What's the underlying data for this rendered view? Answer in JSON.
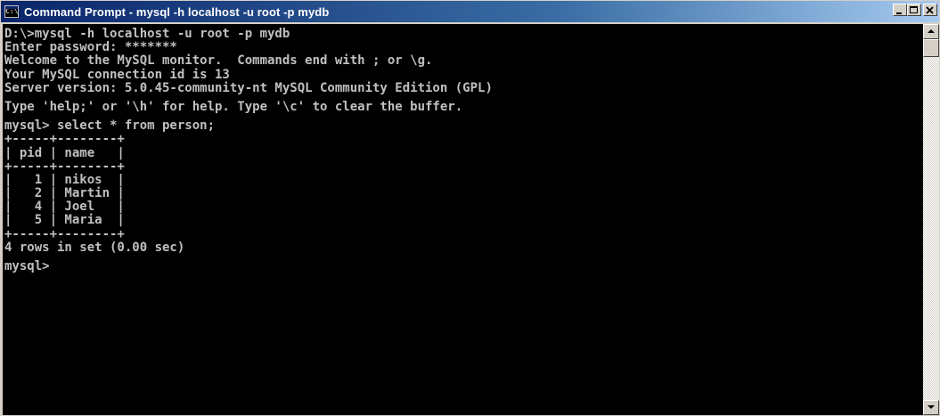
{
  "window": {
    "title": "Command Prompt - mysql -h localhost -u root -p mydb",
    "icon_label": "C:\\",
    "icon": "console-icon"
  },
  "buttons": {
    "minimize": "minimize-icon",
    "maximize": "maximize-icon",
    "close": "close-icon"
  },
  "console": {
    "lines": [
      "D:\\>mysql -h localhost -u root -p mydb",
      "Enter password: *******",
      "Welcome to the MySQL monitor.  Commands end with ; or \\g.",
      "Your MySQL connection id is 13",
      "Server version: 5.0.45-community-nt MySQL Community Edition (GPL)",
      "",
      "Type 'help;' or '\\h' for help. Type '\\c' to clear the buffer.",
      "",
      "mysql> select * from person;",
      "+-----+--------+",
      "| pid | name   |",
      "+-----+--------+",
      "|   1 | nikos  |",
      "|   2 | Martin |",
      "|   4 | Joel   |",
      "|   5 | Maria  |",
      "+-----+--------+",
      "4 rows in set (0.00 sec)",
      "",
      "mysql>"
    ]
  },
  "query_result": {
    "columns": [
      "pid",
      "name"
    ],
    "rows": [
      [
        "1",
        "nikos"
      ],
      [
        "2",
        "Martin"
      ],
      [
        "4",
        "Joel"
      ],
      [
        "5",
        "Maria"
      ]
    ],
    "summary": "4 rows in set (0.00 sec)"
  }
}
